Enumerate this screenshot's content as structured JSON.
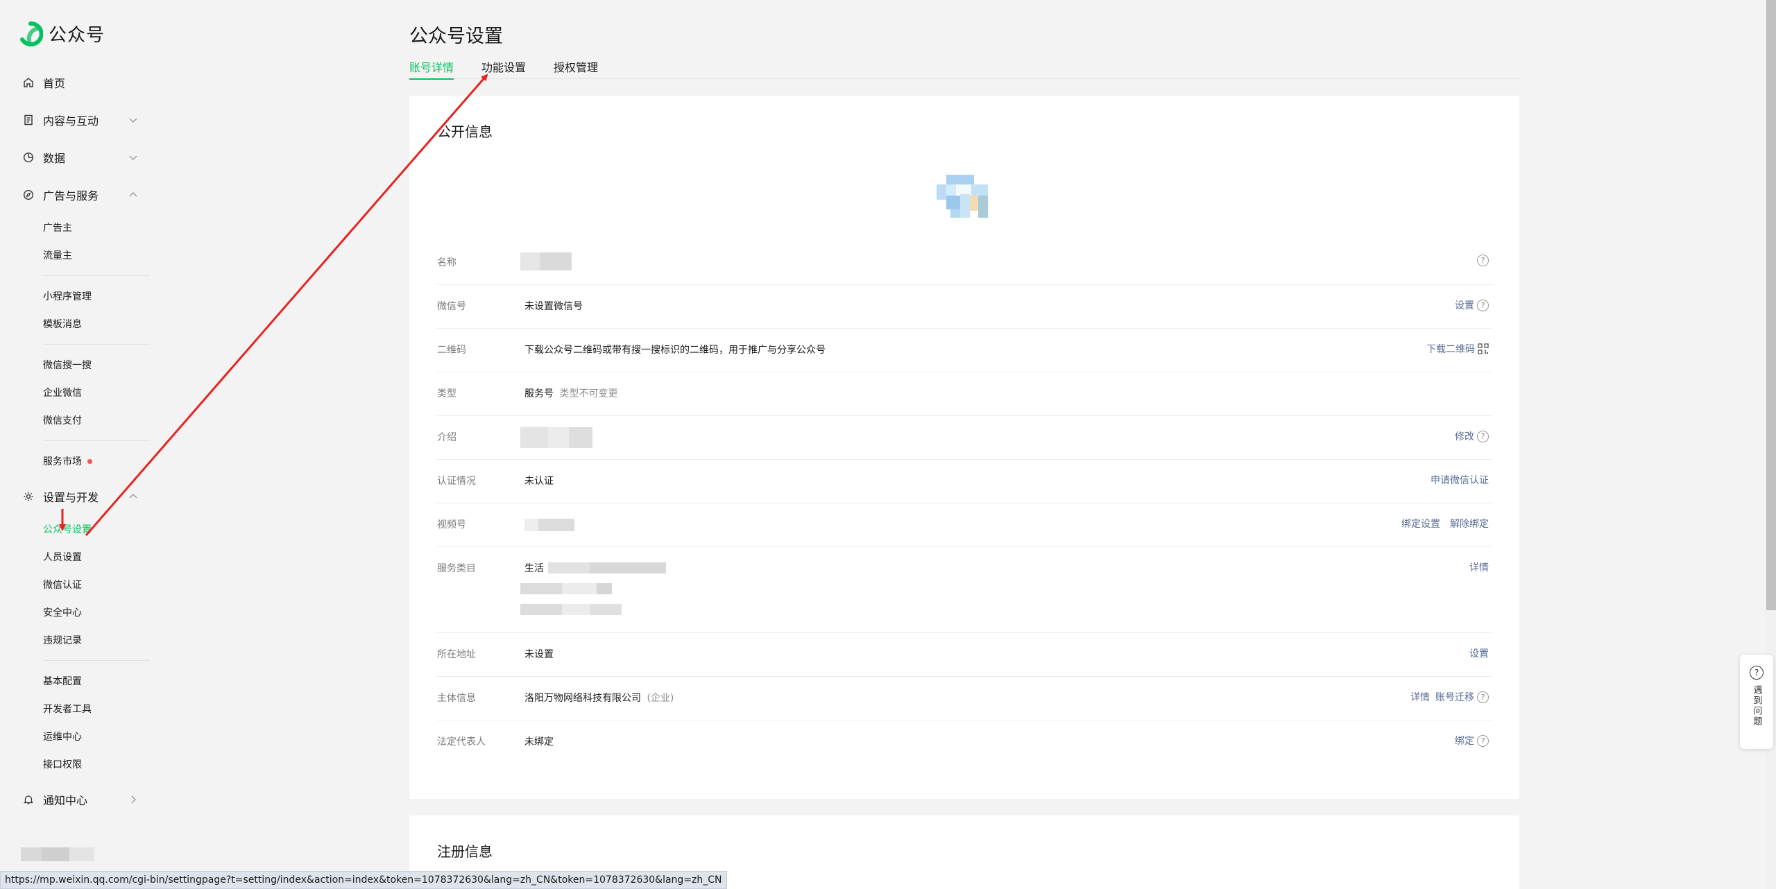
{
  "brand": {
    "name": "公众号"
  },
  "sidebar": {
    "home": "首页",
    "content": "内容与互动",
    "data": "数据",
    "ads": "广告与服务",
    "ads_items": [
      "广告主",
      "流量主"
    ],
    "mini_items": [
      "小程序管理",
      "模板消息"
    ],
    "wechat_items": [
      "微信搜一搜",
      "企业微信",
      "微信支付"
    ],
    "market": "服务市场",
    "settings": "设置与开发",
    "settings_items": [
      "公众号设置",
      "人员设置",
      "微信认证",
      "安全中心",
      "违规记录"
    ],
    "dev_items": [
      "基本配置",
      "开发者工具",
      "运维中心",
      "接口权限"
    ],
    "notice": "通知中心"
  },
  "page": {
    "title": "公众号设置",
    "tabs": [
      "账号详情",
      "功能设置",
      "授权管理"
    ]
  },
  "public_info": {
    "title": "公开信息",
    "rows": [
      {
        "label": "名称",
        "value": "",
        "actions": []
      },
      {
        "label": "微信号",
        "value": "未设置微信号",
        "actions": [
          "设置"
        ]
      },
      {
        "label": "二维码",
        "value": "下载公众号二维码或带有搜一搜标识的二维码，用于推广与分享公众号",
        "actions": [
          "下载二维码"
        ]
      },
      {
        "label": "类型",
        "value": "服务号",
        "note": "类型不可变更",
        "actions": []
      },
      {
        "label": "介绍",
        "value": "",
        "actions": [
          "修改"
        ]
      },
      {
        "label": "认证情况",
        "value": "未认证",
        "actions": [
          "申请微信认证"
        ]
      },
      {
        "label": "视频号",
        "value": "",
        "actions": [
          "绑定设置",
          "解除绑定"
        ]
      },
      {
        "label": "服务类目",
        "value": "生活",
        "sub2": "...生活",
        "actions": [
          "详情"
        ]
      },
      {
        "label": "所在地址",
        "value": "未设置",
        "actions": [
          "设置"
        ]
      },
      {
        "label": "主体信息",
        "value": "洛阳万物网络科技有限公司",
        "note": "(企业)",
        "actions": [
          "详情",
          "账号迁移"
        ]
      },
      {
        "label": "法定代表人",
        "value": "未绑定",
        "actions": [
          "绑定"
        ]
      }
    ]
  },
  "register_info": {
    "title": "注册信息"
  },
  "help": {
    "label": "遇到问题"
  },
  "status_url": "https://mp.weixin.qq.com/cgi-bin/settingpage?t=setting/index&action=index&token=1078372630&lang=zh_CN&token=1078372630&lang=zh_CN",
  "colors": {
    "accent": "#07c160",
    "link": "#576b95",
    "arrow": "#e8231f"
  }
}
